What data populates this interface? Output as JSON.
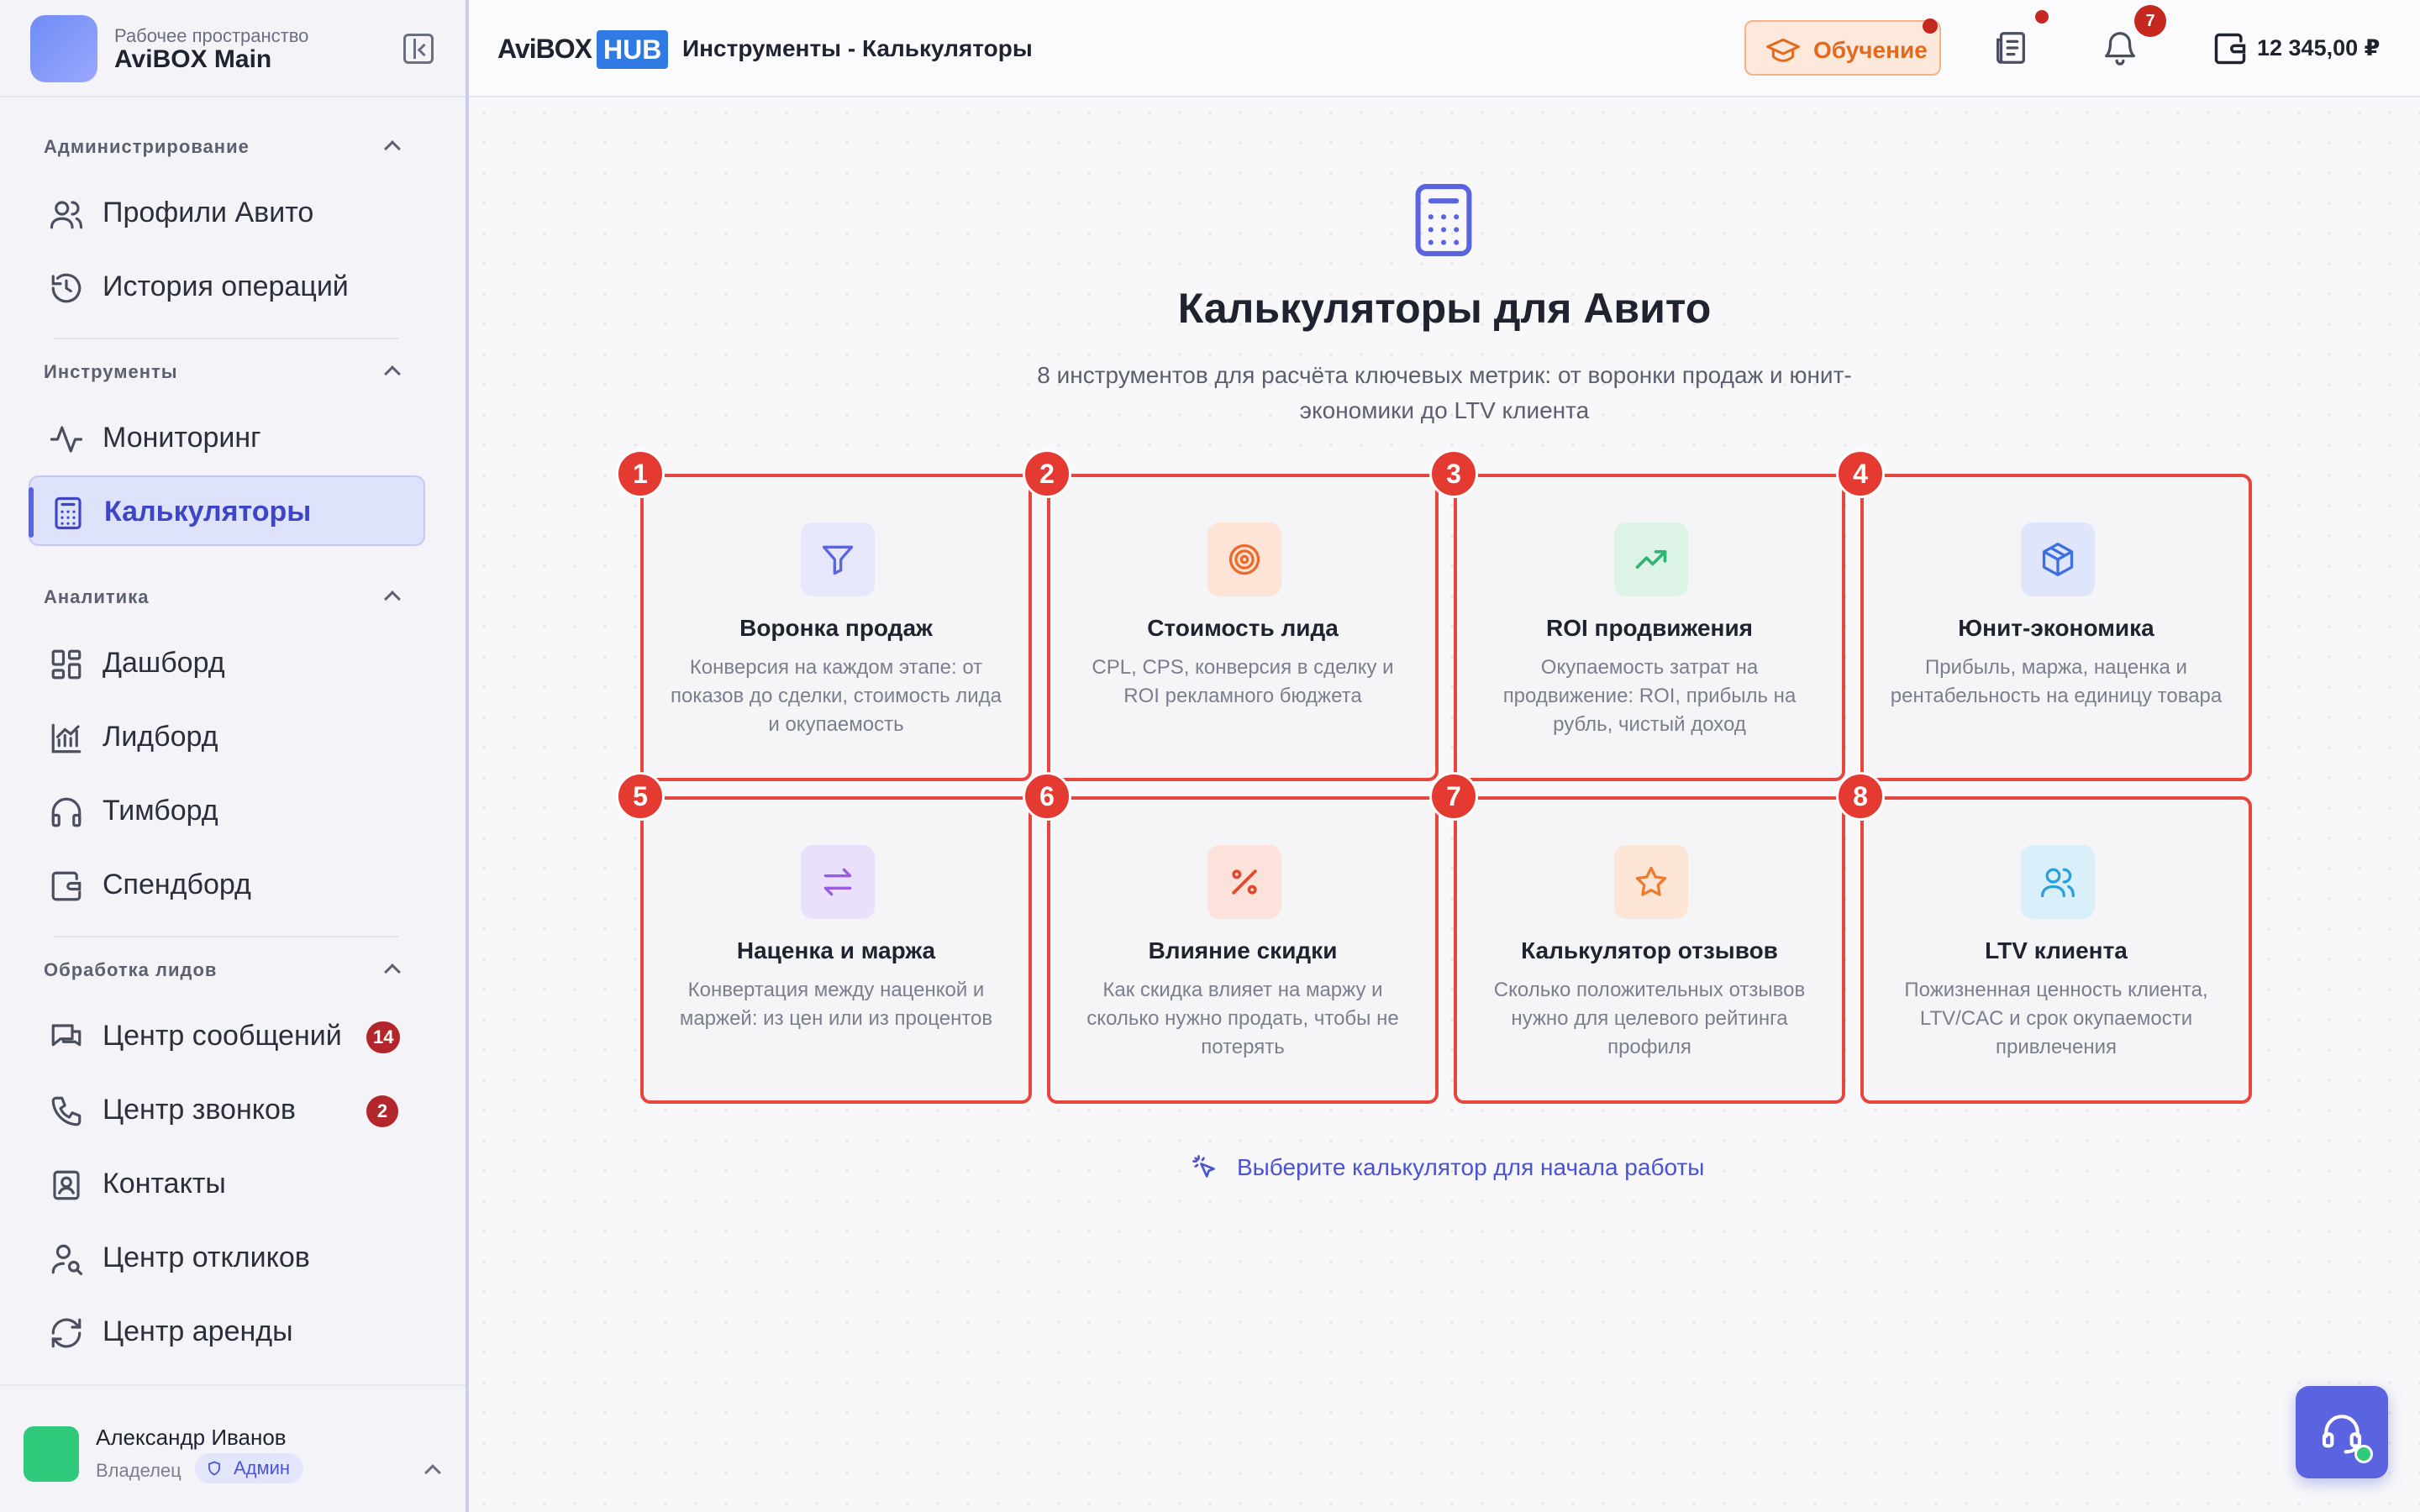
{
  "workspace": {
    "label": "Рабочее пространство",
    "name": "AviBOX Main"
  },
  "sidebar": {
    "sections": [
      {
        "title": "Администрирование",
        "items": [
          {
            "label": "Профили Авито",
            "icon": "users-icon"
          },
          {
            "label": "История операций",
            "icon": "history-icon"
          }
        ]
      },
      {
        "title": "Инструменты",
        "items": [
          {
            "label": "Мониторинг",
            "icon": "activity-icon"
          },
          {
            "label": "Калькуляторы",
            "icon": "calculator-icon",
            "active": true
          }
        ]
      },
      {
        "title": "Аналитика",
        "items": [
          {
            "label": "Дашборд",
            "icon": "dashboard-icon"
          },
          {
            "label": "Лидборд",
            "icon": "chart-icon"
          },
          {
            "label": "Тимборд",
            "icon": "headphones-icon"
          },
          {
            "label": "Спендборд",
            "icon": "wallet-icon"
          }
        ]
      },
      {
        "title": "Обработка лидов",
        "items": [
          {
            "label": "Центр сообщений",
            "icon": "messages-icon",
            "badge": "14"
          },
          {
            "label": "Центр звонков",
            "icon": "phone-icon",
            "badge": "2"
          },
          {
            "label": "Контакты",
            "icon": "contacts-icon"
          },
          {
            "label": "Центр откликов",
            "icon": "user-search-icon"
          },
          {
            "label": "Центр аренды",
            "icon": "refresh-icon"
          }
        ]
      }
    ]
  },
  "user": {
    "name": "Александр Иванов",
    "role": "Владелец",
    "badge": "Админ"
  },
  "topbar": {
    "logo": "AviBOX",
    "logo_badge": "HUB",
    "breadcrumb": "Инструменты - Калькуляторы",
    "learn_label": "Обучение",
    "notifications_count": "7",
    "balance": "12 345,00 ₽"
  },
  "main": {
    "title": "Калькуляторы для Авито",
    "subtitle": "8 инструментов для расчёта ключевых метрик: от воронки продаж и юнит-экономики до LTV клиента",
    "hint": "Выберите калькулятор для начала работы",
    "cards": [
      {
        "num": "1",
        "title": "Воронка продаж",
        "desc": "Конверсия на каждом этапе: от показов до сделки, стоимость лида и окупаемость",
        "icon": "funnel-icon",
        "bg": "#e6e7fb",
        "fg": "#5b64e0"
      },
      {
        "num": "2",
        "title": "Стоимость лида",
        "desc": "CPL, CPS, конверсия в сделку и ROI рекламного бюджета",
        "icon": "target-icon",
        "bg": "#fde4d6",
        "fg": "#ec6a2a"
      },
      {
        "num": "3",
        "title": "ROI продвижения",
        "desc": "Окупаемость затрат на продвижение: ROI, прибыль на рубль, чистый доход",
        "icon": "trending-up-icon",
        "bg": "#dcf3e6",
        "fg": "#2bb673"
      },
      {
        "num": "4",
        "title": "Юнит-экономика",
        "desc": "Прибыль, маржа, наценка и рентабельность на единицу товара",
        "icon": "box-icon",
        "bg": "#dfe6fb",
        "fg": "#3c6fe0"
      },
      {
        "num": "5",
        "title": "Наценка и маржа",
        "desc": "Конвертация между наценкой и маржей: из цен или из процентов",
        "icon": "swap-icon",
        "bg": "#ebe0fb",
        "fg": "#9a5ae8"
      },
      {
        "num": "6",
        "title": "Влияние скидки",
        "desc": "Как скидка влияет на маржу и сколько нужно продать, чтобы не потерять",
        "icon": "percent-icon",
        "bg": "#fde2dc",
        "fg": "#e2482e"
      },
      {
        "num": "7",
        "title": "Калькулятор отзывов",
        "desc": "Сколько положительных отзывов нужно для целевого рейтинга профиля",
        "icon": "star-icon",
        "bg": "#fde5d6",
        "fg": "#ee7a2e"
      },
      {
        "num": "8",
        "title": "LTV клиента",
        "desc": "Пожизненная ценность клиента, LTV/CAC и срок окупаемости привлечения",
        "icon": "users-icon",
        "bg": "#d9eff9",
        "fg": "#2a9fd8"
      }
    ]
  },
  "colors": {
    "accent": "#5b64e0",
    "highlight_border": "#e7463f",
    "badge": "#c4281f"
  }
}
